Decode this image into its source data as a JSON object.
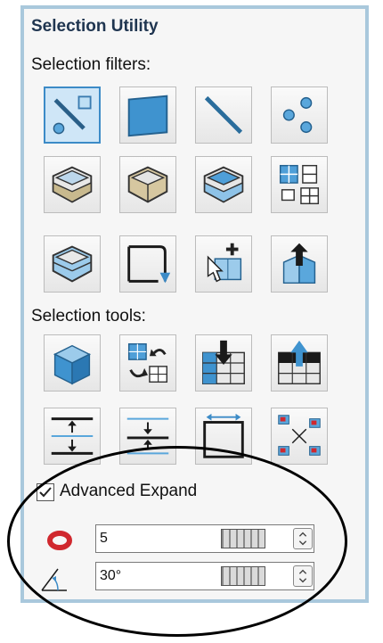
{
  "panel": {
    "title": "Selection Utility",
    "filters_label": "Selection filters:",
    "filters": [
      {
        "icon": "select-all-icon",
        "selected": true
      },
      {
        "icon": "face-filter-icon"
      },
      {
        "icon": "edge-filter-icon"
      },
      {
        "icon": "vertex-filter-icon"
      },
      {
        "icon": "body-bottom-face-icon"
      },
      {
        "icon": "body-side-face-icon"
      },
      {
        "icon": "body-top-face-icon"
      },
      {
        "icon": "grid-filter-icon"
      },
      {
        "icon": "body-all-faces-icon"
      },
      {
        "icon": "sketch-filter-icon"
      },
      {
        "icon": "add-selection-icon"
      },
      {
        "icon": "extrude-feature-icon"
      }
    ],
    "tools_label": "Selection tools:",
    "tools": [
      {
        "icon": "select-body-icon"
      },
      {
        "icon": "swap-selection-icon"
      },
      {
        "icon": "expand-down-icon"
      },
      {
        "icon": "expand-up-icon"
      },
      {
        "icon": "expand-both-icon"
      },
      {
        "icon": "contract-icon"
      },
      {
        "icon": "select-boundary-icon"
      },
      {
        "icon": "scatter-select-icon"
      }
    ],
    "advanced_expand": {
      "label": "Advanced Expand",
      "checked": true
    },
    "fields": [
      {
        "icon": "loop-icon",
        "value": "5"
      },
      {
        "icon": "angle-icon",
        "value": "30°"
      }
    ]
  },
  "colors": {
    "accent": "#3c8bc7",
    "panel_border": "#a9c8dc",
    "loop_red": "#d0282e"
  }
}
